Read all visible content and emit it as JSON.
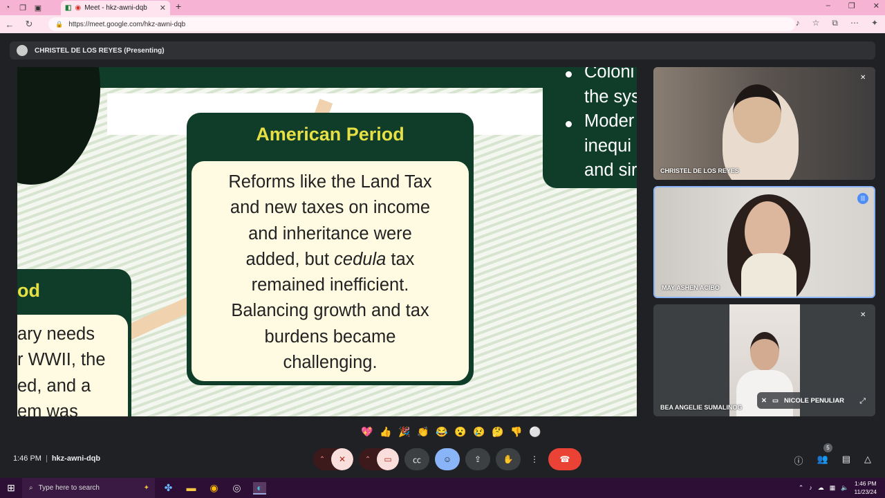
{
  "browser": {
    "tab_title": "Meet - hkz-awni-dqb",
    "url": "https://meet.google.com/hkz-awni-dqb",
    "new_tab": "+"
  },
  "meet": {
    "presenter_label": "CHRISTEL DE LOS REYES (Presenting)",
    "slide": {
      "center_heading": "American Period",
      "center_lines": [
        "Reforms like the Land Tax",
        "and new taxes on income",
        "and inheritance were",
        "added, but ",
        "cedula",
        " tax",
        "remained inefficient.",
        "Balancing growth and tax",
        "burdens became",
        "challenging."
      ],
      "left_heading": "od",
      "left_lines": [
        "ary needs",
        "r WWII, the",
        "ed, and a",
        "em was"
      ],
      "right_lines": [
        "Coloni",
        "the sys",
        "Moder",
        "inequi",
        "and sir"
      ]
    },
    "participants": [
      {
        "name": "CHRISTEL DE LOS REYES",
        "muted": true
      },
      {
        "name": "MAY ASHEN ACIBO",
        "speaking": true
      },
      {
        "name": "BEA ANGELIE SUMALINOG",
        "muted": true,
        "sub_name": "NICOLE PENULIAR"
      }
    ],
    "reactions": [
      "💖",
      "👍",
      "🎉",
      "👏",
      "😂",
      "😮",
      "😢",
      "🤔",
      "👎",
      "⚪"
    ],
    "bottom": {
      "time": "1:46 PM",
      "meeting_code": "hkz-awni-dqb",
      "people_count": "5"
    }
  },
  "taskbar": {
    "search_placeholder": "Type here to search",
    "time": "1:46 PM",
    "date": "11/23/24"
  }
}
